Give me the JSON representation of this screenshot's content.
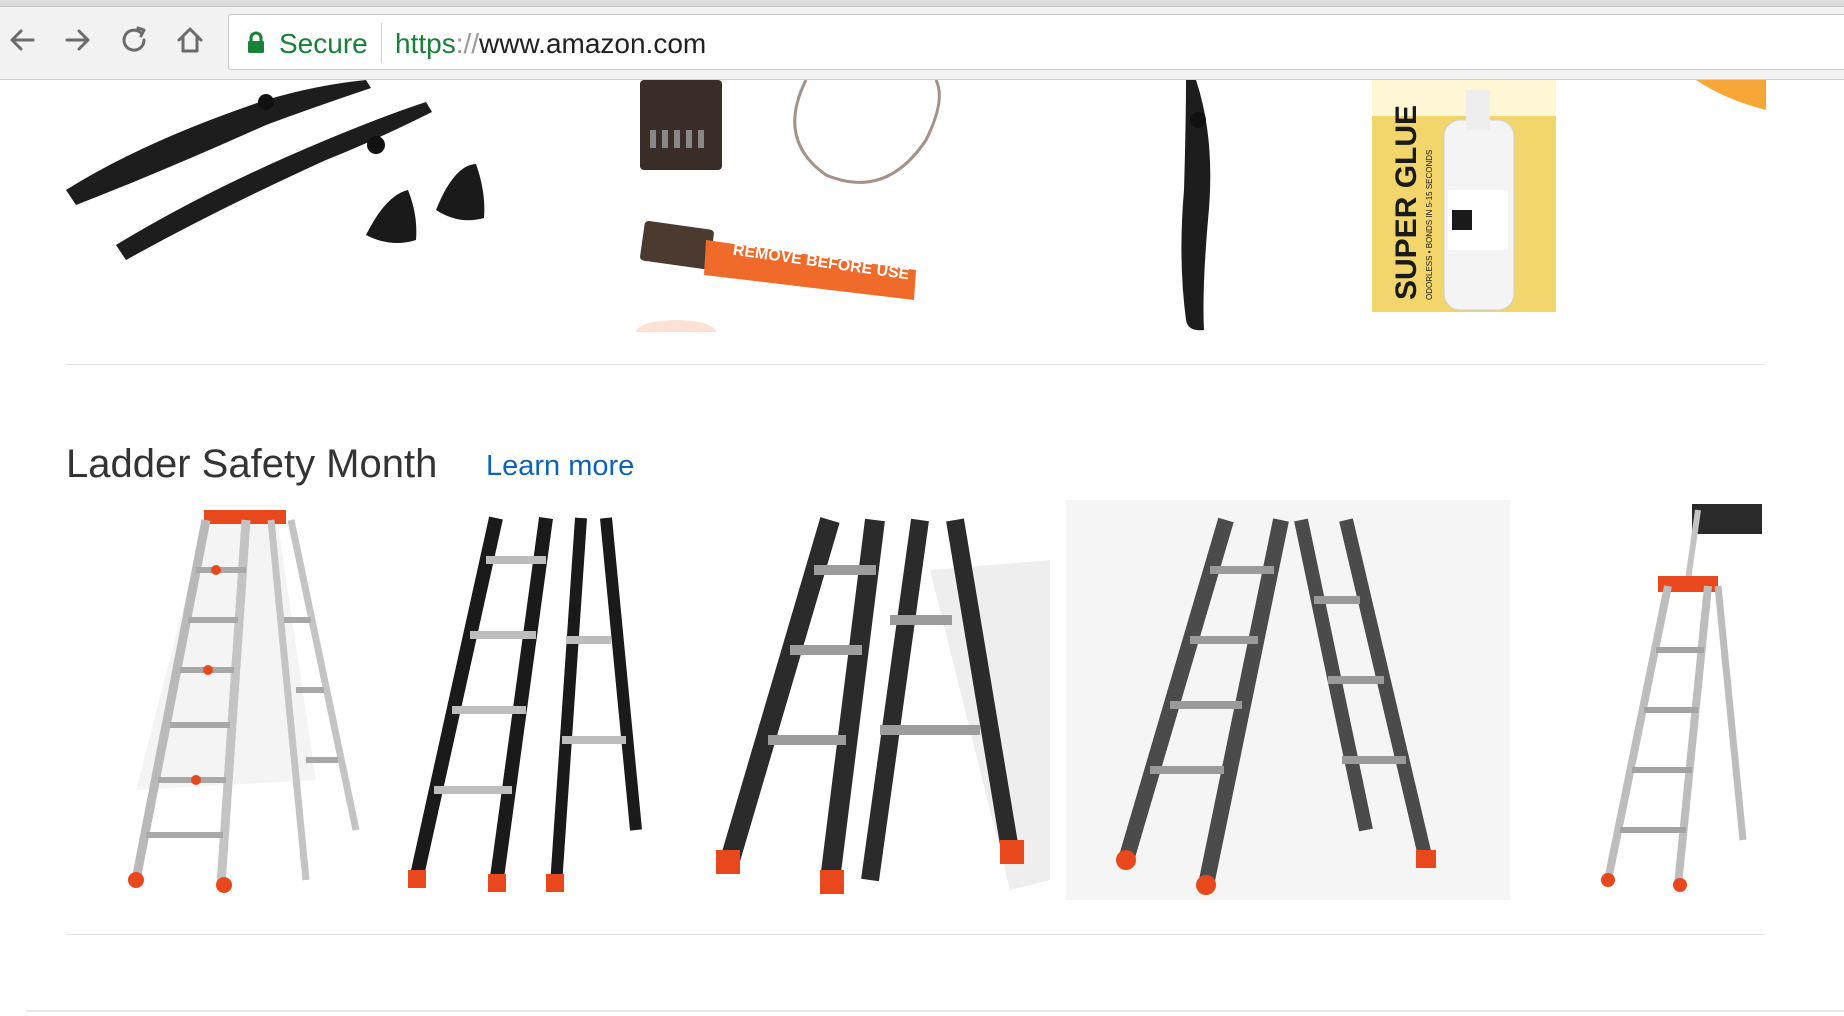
{
  "browser": {
    "nav": {
      "back_icon": "arrow-left-icon",
      "forward_icon": "arrow-right-icon",
      "reload_icon": "reload-icon",
      "home_icon": "home-icon"
    },
    "omnibox": {
      "security_label": "Secure",
      "url_scheme": "https",
      "url_separator": "://",
      "url_host": "www.amazon.com"
    }
  },
  "top_strip": {
    "items": [
      {
        "name": "propellers",
        "alt": "Black propellers with spinner caps"
      },
      {
        "name": "receiver",
        "label": "REMOVE BEFORE USE"
      },
      {
        "name": "propeller-single",
        "alt": "Single black propeller"
      },
      {
        "name": "super-glue",
        "label": "SUPER GLUE",
        "sub": "ODORLESS • BONDS IN 5-15 SECONDS"
      }
    ]
  },
  "ladder_section": {
    "title": "Ladder Safety Month",
    "learn_more": "Learn more",
    "items": [
      {
        "name": "ladder-silver-stepladder"
      },
      {
        "name": "ladder-black-multi"
      },
      {
        "name": "ladder-dark-horse"
      },
      {
        "name": "ladder-gray-multi"
      },
      {
        "name": "ladder-platform-partial"
      }
    ]
  },
  "colors": {
    "secure_green": "#188038",
    "link_blue": "#0e64b4",
    "ladder_orange": "#e8481c"
  }
}
